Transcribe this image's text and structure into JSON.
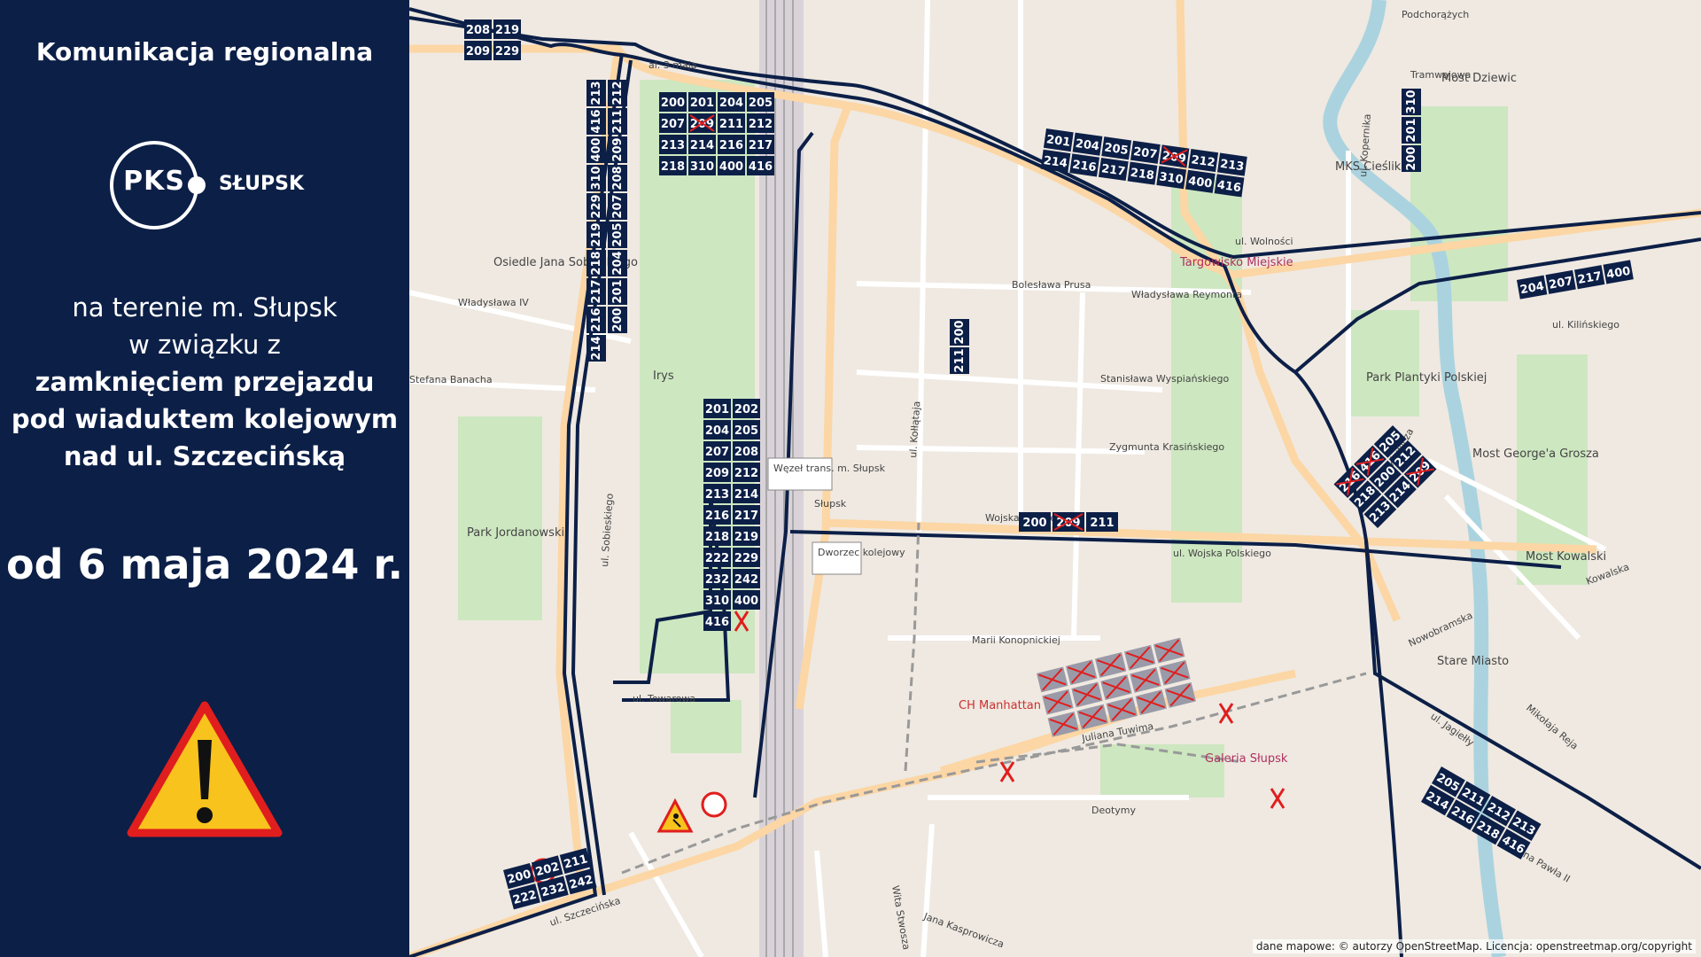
{
  "sidebar": {
    "title": "Komunikacja regionalna",
    "logo_main": "PKS",
    "logo_city": "SŁUPSK",
    "line1": "na terenie m. Słupsk",
    "line2": "w związku z",
    "line3": "zamknięciem przejazdu",
    "line4": "pod wiaduktem kolejowym",
    "line5": "nad ul. Szczecińską",
    "date": "od 6 maja 2024 r.",
    "icon": "warning-icon"
  },
  "colors": {
    "navy": "#0c1f47",
    "closed": "#e01e1e",
    "park": "#cde7c0",
    "warning": "#f7c31c"
  },
  "map": {
    "streets": [
      "al. 3 maja",
      "ul. Wolności",
      "ul. Kilińskiego",
      "Władysława IV",
      "Stefana Banacha",
      "ul. Sobieskiego",
      "ul. Towarowa",
      "ul. Szczecińska",
      "ul. Kołłątaja",
      "Wojska Polskiego",
      "ul. Wojska Polskiego",
      "Marii Konopnickiej",
      "Juliana Tuwima",
      "Deotymy",
      "Bolesława Prusa",
      "Władysława Reymonta",
      "Stanisława Wyspiańskiego",
      "Zygmunta Krasińskiego",
      "ul. Kopernika",
      "ul. Sienkiewicza",
      "ul. Jagiełły",
      "ul. Jana Pawła II",
      "Tramwajowa",
      "Podchorążych",
      "Jana Kasprowicza",
      "Wita Stwosza",
      "Mikołaja Reja",
      "Kowalska",
      "Nowobramska"
    ],
    "places": [
      "Irys",
      "Osiedle Jana Sobieskiego",
      "Park Jordanowski",
      "Targowisko Miejskie",
      "Park Plantyki Polskiej",
      "Stare Miasto",
      "Galeria Słupsk",
      "Most Dziewic",
      "Most George'a Grosza",
      "Most Kowalski",
      "MKS Cieśliki",
      "CH Manhattan"
    ],
    "stops": [
      "Węzeł trans. m. Słupsk",
      "Dworzec kolejowy",
      "Słupsk"
    ],
    "groups": {
      "g1": [
        "208",
        "219",
        "209",
        "229"
      ],
      "g2": [
        "200",
        "201",
        "204",
        "205",
        "207",
        "209",
        "211",
        "212",
        "213",
        "214",
        "216",
        "217",
        "218",
        "310",
        "400",
        "416"
      ],
      "g3": [
        "201",
        "204",
        "205",
        "207",
        "209",
        "212",
        "213",
        "214",
        "216",
        "217",
        "218",
        "310",
        "400",
        "416"
      ],
      "g4": [
        "213",
        "212",
        "416",
        "211",
        "400",
        "209",
        "310",
        "208",
        "229",
        "207",
        "219",
        "205",
        "218",
        "204",
        "217",
        "201",
        "216",
        "200",
        "214"
      ],
      "g5": [
        "201",
        "202",
        "204",
        "205",
        "207",
        "208",
        "209",
        "212",
        "213",
        "214",
        "216",
        "217",
        "218",
        "219",
        "222",
        "229",
        "232",
        "242",
        "310",
        "400",
        "416"
      ],
      "g6": [
        "200",
        "211"
      ],
      "g7": [
        "310",
        "201",
        "200"
      ],
      "g8": [
        "204",
        "207",
        "217",
        "400"
      ],
      "g9": [
        "205",
        "212",
        "209",
        "416",
        "200",
        "214",
        "216",
        "218",
        "213"
      ],
      "g10": [
        "200",
        "209",
        "211"
      ],
      "g11": [
        "205",
        "211",
        "212",
        "213",
        "214",
        "216",
        "218",
        "416"
      ],
      "g12": [
        "200",
        "202",
        "211",
        "222",
        "232",
        "242"
      ]
    },
    "attribution": "dane mapowe: © autorzy OpenStreetMap. Licencja: openstreetmap.org/copyright"
  }
}
